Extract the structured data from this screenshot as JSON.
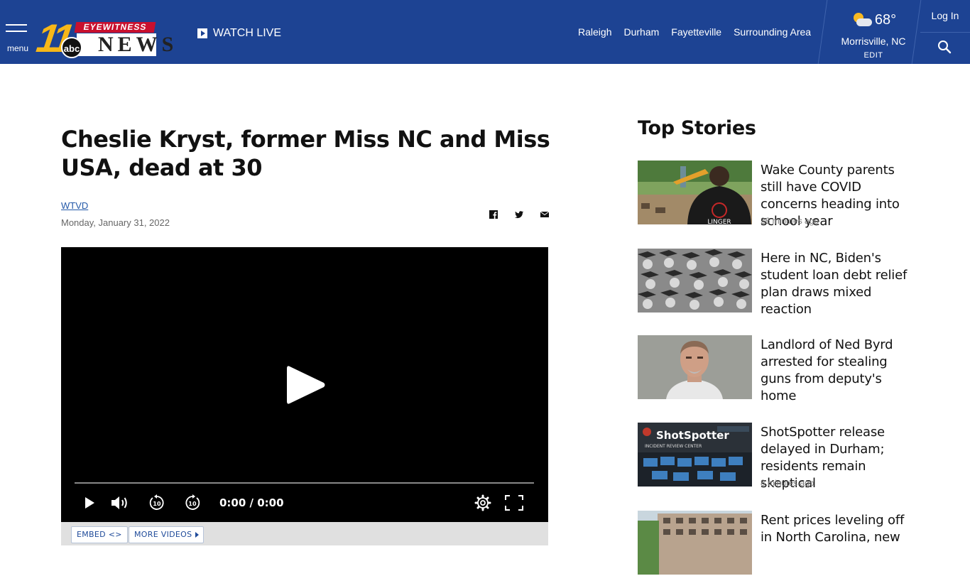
{
  "header": {
    "menu_label": "menu",
    "logo": {
      "number": "11",
      "top": "EYEWITNESS",
      "network": "abc",
      "word": "NEWS"
    },
    "watch_live": "WATCH LIVE",
    "nav": [
      "Raleigh",
      "Durham",
      "Fayetteville",
      "Surrounding Area"
    ],
    "weather": {
      "icon": "partly-sunny-icon",
      "temp": "68°",
      "location": "Morrisville, NC",
      "edit": "EDIT"
    },
    "login": "Log In",
    "search_icon": "search-icon",
    "colors": {
      "bar": "#1d4393",
      "logo_gold": "#f7b718",
      "logo_red": "#c8102e"
    }
  },
  "article": {
    "headline": "Cheslie Kryst, former Miss NC and Miss USA, dead at 30",
    "byline": "WTVD",
    "date": "Monday, January 31, 2022",
    "share_icons": [
      "facebook-icon",
      "twitter-icon",
      "email-icon"
    ],
    "player": {
      "time": "0:00 / 0:00",
      "embed_label": "EMBED <>",
      "more_videos_label": "MORE VIDEOS"
    }
  },
  "sidebar": {
    "title": "Top Stories",
    "stories": [
      {
        "title": "Wake County parents still have COVID concerns heading into school year",
        "ago": "26 minutes ago"
      },
      {
        "title": "Here in NC, Biden's student loan debt relief plan draws mixed reaction",
        "ago": ""
      },
      {
        "title": "Landlord of Ned Byrd arrested for stealing guns from deputy's home",
        "ago": ""
      },
      {
        "title": "ShotSpotter release delayed in Durham; residents remain skeptical",
        "ago": "8 minutes ago"
      },
      {
        "title": "Rent prices leveling off in North Carolina, new",
        "ago": ""
      }
    ],
    "thumb_texts": {
      "shirt": "LINGER",
      "shotspotter": "ShotSpotter",
      "shotspotter_sub": "INCIDENT REVIEW CENTER"
    }
  }
}
